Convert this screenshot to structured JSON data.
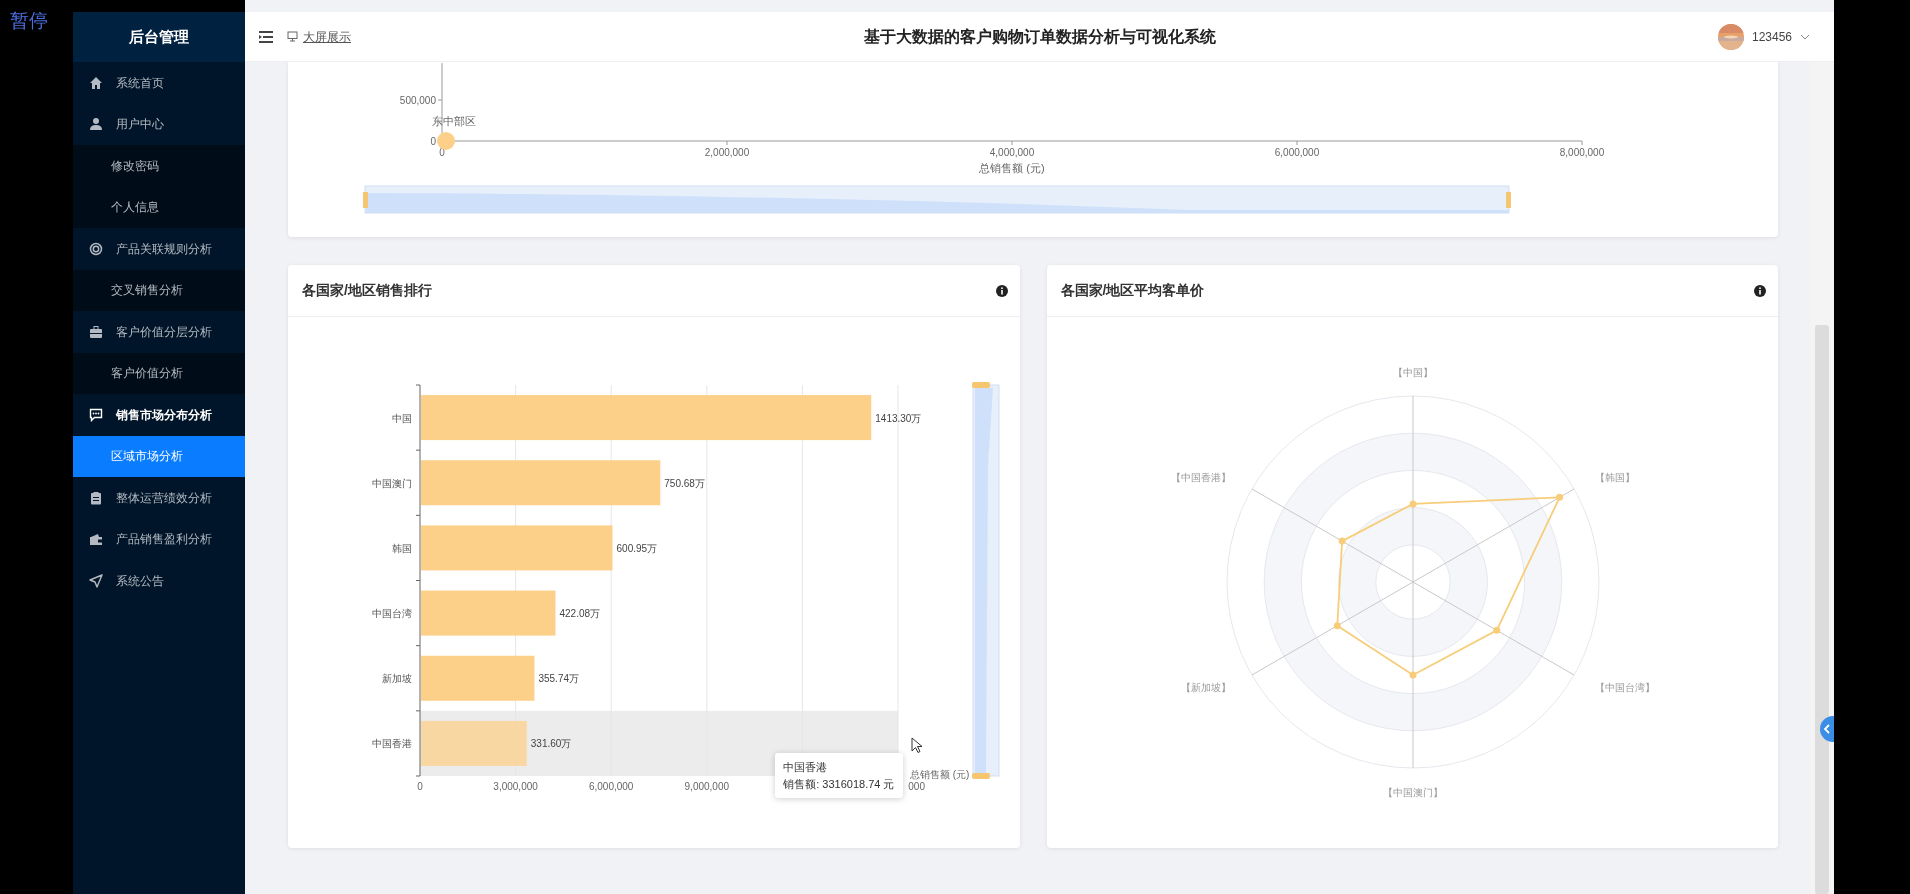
{
  "player": {
    "pause_label": "暂停"
  },
  "sidebar": {
    "title": "后台管理",
    "items": [
      {
        "label": "系统首页"
      },
      {
        "label": "用户中心",
        "children": [
          {
            "label": "修改密码",
            "selected": false
          },
          {
            "label": "个人信息",
            "selected": false
          }
        ]
      },
      {
        "label": "产品关联规则分析",
        "children": [
          {
            "label": "交叉销售分析",
            "selected": false
          }
        ]
      },
      {
        "label": "客户价值分层分析",
        "children": [
          {
            "label": "客户价值分析",
            "selected": false
          }
        ]
      },
      {
        "label": "销售市场分布分析",
        "children": [
          {
            "label": "区域市场分析",
            "selected": true
          }
        ]
      },
      {
        "label": "整体运营绩效分析"
      },
      {
        "label": "产品销售盈利分析"
      },
      {
        "label": "系统公告"
      }
    ]
  },
  "header": {
    "screen_link": "大屏展示",
    "title": "基于大数据的客户购物订单数据分析与可视化系统",
    "user": "123456"
  },
  "top_chart": {
    "chart_data": {
      "type": "scatter",
      "xlabel": "总销售额 (元)",
      "x": [
        0
      ],
      "series": [
        {
          "name": "东中部区",
          "color": "#fdd08a",
          "values": [
            0
          ]
        }
      ],
      "xlim": [
        0,
        8000000
      ],
      "ylim": [
        0,
        950000
      ],
      "xticks": [
        {
          "value": 0,
          "label": "0"
        },
        {
          "value": 2000000,
          "label": "2,000,000"
        },
        {
          "value": 4000000,
          "label": "4,000,000"
        },
        {
          "value": 6000000,
          "label": "6,000,000"
        },
        {
          "value": 8000000,
          "label": "8,000,000"
        }
      ],
      "yticks": [
        {
          "value": 0,
          "label": "0"
        },
        {
          "value": 500000,
          "label": "500,000"
        }
      ]
    }
  },
  "bar_card": {
    "title": "各国家/地区销售排行",
    "chart_data": {
      "type": "bar",
      "orientation": "horizontal",
      "xlabel": "总销售额 (元)",
      "categories": [
        "中国",
        "中国澳门",
        "韩国",
        "中国台湾",
        "新加坡",
        "中国香港"
      ],
      "series": [
        {
          "color": "#fdd08a",
          "values": [
            14130000,
            7510000,
            6010000,
            4220000,
            3560000,
            3320000
          ]
        }
      ],
      "value_labels": [
        "1413.30万",
        "750.68万",
        "600.95万",
        "422.08万",
        "355.74万",
        "331.60万"
      ],
      "xlim": [
        0,
        15000000
      ],
      "grid": true,
      "xticks": [
        {
          "value": 0,
          "label": "0"
        },
        {
          "value": 3000000,
          "label": "3,000,000"
        },
        {
          "value": 6000000,
          "label": "6,000,000"
        },
        {
          "value": 9000000,
          "label": "9,000,000"
        }
      ]
    },
    "highlighted": [
      false,
      false,
      false,
      false,
      false,
      true
    ],
    "tick_fragment": "000",
    "tooltip": {
      "title": "中国香港",
      "text": "销售额: 3316018.74 元"
    }
  },
  "radar_card": {
    "title": "各国家/地区平均客单价",
    "indicators": [
      "【中国】",
      "【韩国】",
      "【中国台湾】",
      "【中国澳门】",
      "【新加坡】",
      "【中国香港】"
    ]
  }
}
